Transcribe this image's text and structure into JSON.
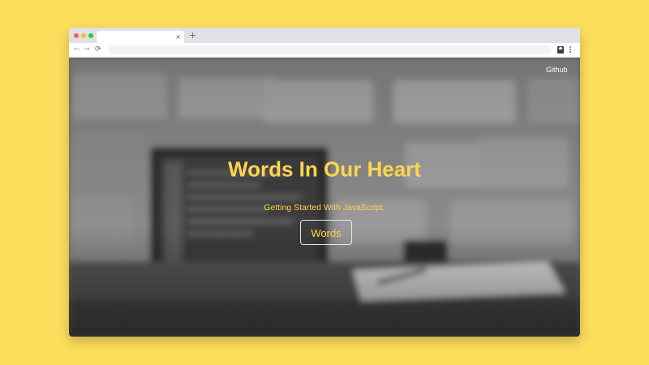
{
  "browser": {
    "tab": {
      "title": "",
      "close_glyph": "×"
    },
    "new_tab_glyph": "+",
    "nav": {
      "back_glyph": "←",
      "forward_glyph": "→",
      "reload_glyph": "⟳"
    },
    "address_bar": {
      "value": ""
    },
    "icons": [
      "close-icon",
      "plus-icon",
      "back-arrow-icon",
      "forward-arrow-icon",
      "reload-icon",
      "extension-icon",
      "menu-icon"
    ]
  },
  "page": {
    "nav": {
      "github_label": "Github"
    },
    "hero": {
      "title": "Words In Our Heart",
      "subtitle": "Getting Started With JavaScript.",
      "button_label": "Words"
    }
  },
  "colors": {
    "desktop_background": "#fddd5c",
    "accent_text": "#fdd54f",
    "button_border": "#e8e8e8"
  }
}
